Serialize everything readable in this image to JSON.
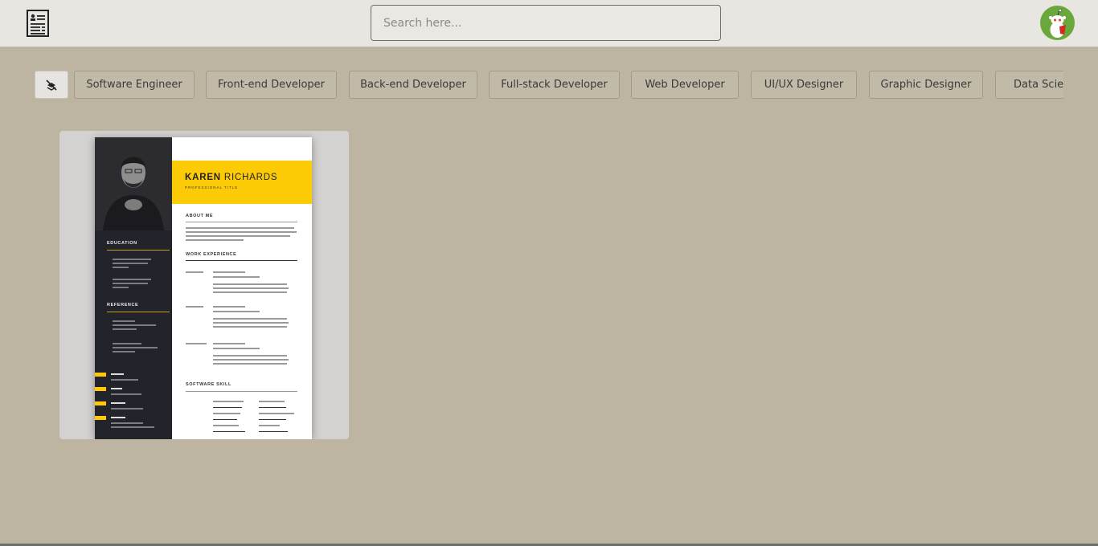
{
  "header": {
    "logo_icon": "resume-document-icon",
    "search_placeholder": "Search here...",
    "avatar_icon": "reddit-mascot-avatar"
  },
  "filters": {
    "clear_icon": "filter-off-icon",
    "chips": [
      "Software Engineer",
      "Front-end Developer",
      "Back-end Developer",
      "Full-stack Developer",
      "Web Developer",
      "UI/UX Designer",
      "Graphic Designer",
      "Data Scientist"
    ]
  },
  "templates": [
    {
      "name_first": "KAREN",
      "name_last": "RICHARDS",
      "professional_title": "PROFESSIONAL TITLE",
      "sections": {
        "about": "ABOUT ME",
        "work": "WORK EXPERIENCE",
        "skills": "SOFTWARE SKILL",
        "education": "EDUCATION",
        "reference": "REFERENCE"
      },
      "contacts": [
        "Phone",
        "Email",
        "Website",
        "Address"
      ]
    }
  ],
  "colors": {
    "page_bg": "#bdb5a2",
    "topbar_bg": "#e7e6e1",
    "accent_yellow": "#fccb06",
    "sidebar_dark": "#23232b"
  }
}
